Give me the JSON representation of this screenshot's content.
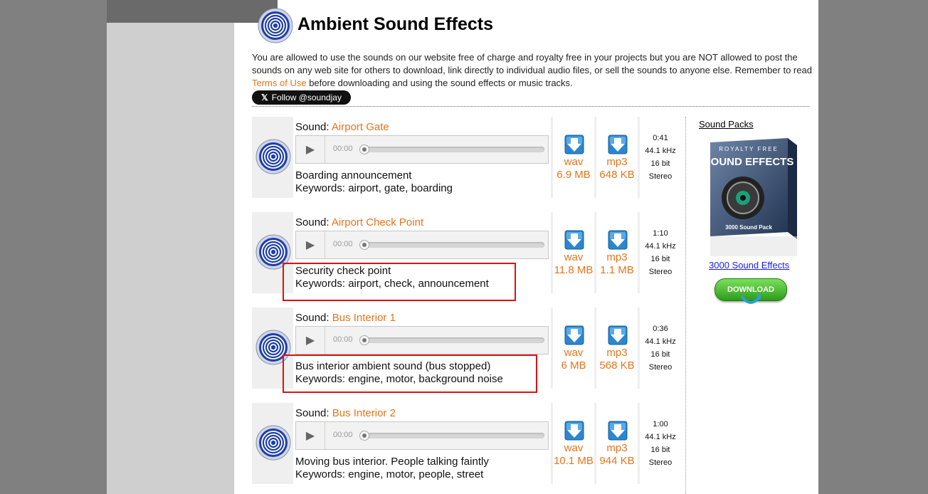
{
  "header": {
    "title": "Ambient Sound Effects",
    "intro_part1": "You are allowed to use the sounds on our website free of charge and royalty free in your projects but you are NOT allowed to post the sounds on any web site for others to download, link directly to individual audio files, or sell the sounds to anyone else. Remember to read ",
    "terms_link": "Terms of Use",
    "intro_part2": " before downloading and using the sound effects or music tracks.",
    "follow_label": "Follow @soundjay"
  },
  "sound_label": "Sound: ",
  "player_time": "00:00",
  "sounds": [
    {
      "name": "Airport Gate",
      "desc": "Boarding announcement",
      "keywords": "Keywords: airport, gate, boarding",
      "wav": "wav",
      "wav_size": "6.9 MB",
      "mp3": "mp3",
      "mp3_size": "648 KB",
      "duration": "0:41",
      "rate": "44.1 kHz",
      "bits": "16 bit",
      "channels": "Stereo"
    },
    {
      "name": "Airport Check Point",
      "desc": "Security check point",
      "keywords": "Keywords: airport, check, announcement",
      "wav": "wav",
      "wav_size": "11.8 MB",
      "mp3": "mp3",
      "mp3_size": "1.1 MB",
      "duration": "1:10",
      "rate": "44.1 kHz",
      "bits": "16 bit",
      "channels": "Stereo"
    },
    {
      "name": "Bus Interior 1",
      "desc": "Bus interior ambient sound (bus stopped)",
      "keywords": "Keywords: engine, motor, background noise",
      "wav": "wav",
      "wav_size": "6 MB",
      "mp3": "mp3",
      "mp3_size": "568 KB",
      "duration": "0:36",
      "rate": "44.1 kHz",
      "bits": "16 bit",
      "channels": "Stereo"
    },
    {
      "name": "Bus Interior 2",
      "desc": "Moving bus interior. People talking faintly",
      "keywords": "Keywords: engine, motor, people, street",
      "wav": "wav",
      "wav_size": "10.1 MB",
      "mp3": "mp3",
      "mp3_size": "944 KB",
      "duration": "1:00",
      "rate": "44.1 kHz",
      "bits": "16 bit",
      "channels": "Stereo"
    }
  ],
  "sidebar": {
    "title": "Sound Packs",
    "box_line1": "ROYALTY FREE",
    "box_line2": "SOUND EFFECTS",
    "box_line3": "3000 Sound Pack",
    "pack_link": "3000 Sound Effects",
    "download_label": "DOWNLOAD"
  },
  "colors": {
    "accent": "#e8731c",
    "link": "#1a1aee",
    "highlight": "#e01010",
    "icon": "#1f3fa8"
  }
}
